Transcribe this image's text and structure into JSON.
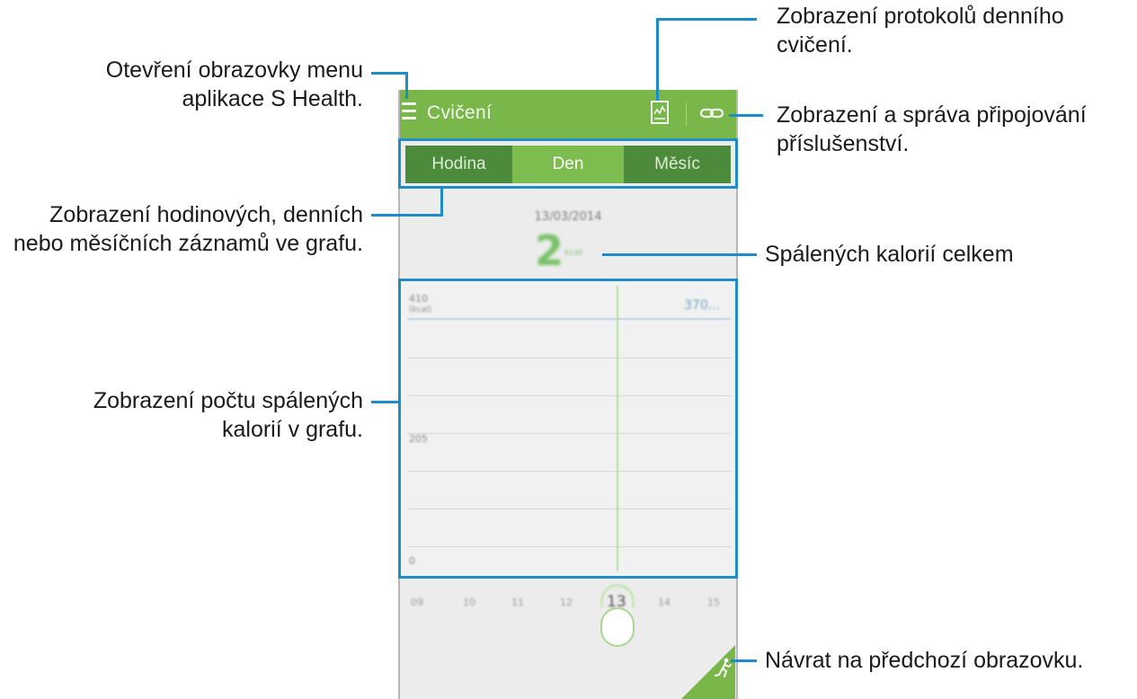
{
  "app": {
    "title": "Cvičení",
    "icons": {
      "menu": "menu-icon",
      "log": "log-chart-icon",
      "link": "link-icon",
      "back": "running-person-icon"
    },
    "colors": {
      "accent": "#79b74b",
      "segment_dark": "#4c8a3c",
      "callout_line": "#1e8cc8"
    }
  },
  "tabs": [
    {
      "label": "Hodina",
      "selected": false
    },
    {
      "label": "Den",
      "selected": true
    },
    {
      "label": "Měsíc",
      "selected": false
    }
  ],
  "summary": {
    "date": "13/03/2014",
    "value": "2",
    "unit": "kcal"
  },
  "graph": {
    "y_ticks": [
      "410",
      "205",
      "0"
    ],
    "y_unit": "(kcal)",
    "goal_label": "370...",
    "x_ticks": [
      "09",
      "10",
      "11",
      "12",
      "13",
      "14",
      "15"
    ],
    "selected_x": "13"
  },
  "callouts": {
    "menu": "Otevření obrazovky menu aplikace S Health.",
    "log": "Zobrazení protokolů denního cvičení.",
    "accessory": "Zobrazení a správa připojování příslušenství.",
    "records": "Zobrazení hodinových, denních nebo měsíčních záznamů ve grafu.",
    "total": "Spálených kalorií celkem",
    "graph": "Zobrazení počtu spálených kalorií v grafu.",
    "back": "Návrat na předchozí obrazovku."
  }
}
